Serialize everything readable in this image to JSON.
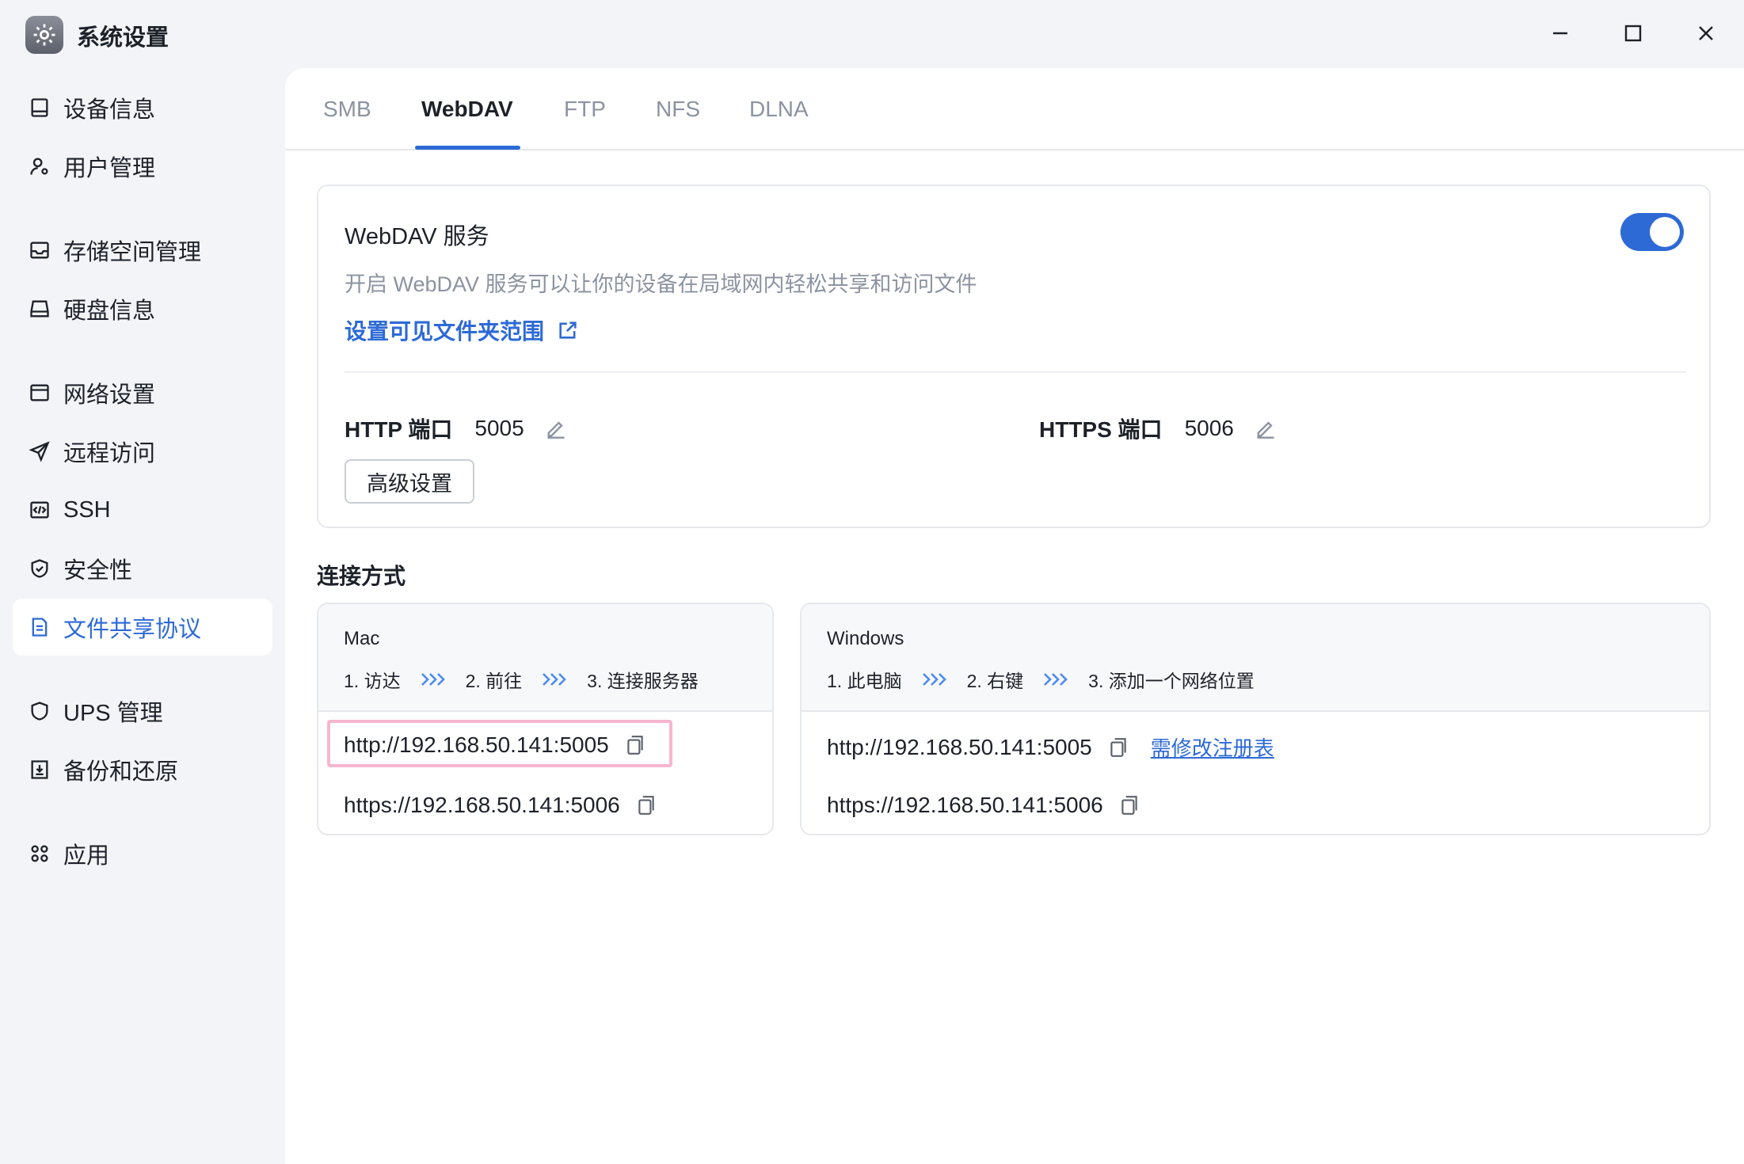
{
  "window": {
    "title": "系统设置"
  },
  "sidebar": {
    "items": [
      {
        "label": "设备信息",
        "icon": "device-icon"
      },
      {
        "label": "用户管理",
        "icon": "user-gear-icon"
      },
      {
        "label": "存储空间管理",
        "icon": "inbox-icon"
      },
      {
        "label": "硬盘信息",
        "icon": "disk-icon"
      },
      {
        "label": "网络设置",
        "icon": "network-icon"
      },
      {
        "label": "远程访问",
        "icon": "send-icon"
      },
      {
        "label": "SSH",
        "icon": "code-icon"
      },
      {
        "label": "安全性",
        "icon": "shield-check-icon"
      },
      {
        "label": "文件共享协议",
        "icon": "document-icon",
        "active": true
      },
      {
        "label": "UPS 管理",
        "icon": "shield-icon"
      },
      {
        "label": "备份和还原",
        "icon": "backup-icon"
      },
      {
        "label": "应用",
        "icon": "apps-icon"
      }
    ]
  },
  "tabs": [
    {
      "label": "SMB"
    },
    {
      "label": "WebDAV",
      "active": true
    },
    {
      "label": "FTP"
    },
    {
      "label": "NFS"
    },
    {
      "label": "DLNA"
    }
  ],
  "service": {
    "title": "WebDAV 服务",
    "description": "开启 WebDAV 服务可以让你的设备在局域网内轻松共享和访问文件",
    "folder_link": "设置可见文件夹范围",
    "enabled": true,
    "http_label": "HTTP 端口",
    "http_port": "5005",
    "https_label": "HTTPS 端口",
    "https_port": "5006",
    "advanced_button": "高级设置"
  },
  "connection": {
    "title": "连接方式",
    "mac": {
      "os": "Mac",
      "steps": [
        "1. 访达",
        "2. 前往",
        "3. 连接服务器"
      ],
      "http_url": "http://192.168.50.141:5005",
      "https_url": "https://192.168.50.141:5006"
    },
    "windows": {
      "os": "Windows",
      "steps": [
        "1. 此电脑",
        "2. 右键",
        "3. 添加一个网络位置"
      ],
      "http_url": "http://192.168.50.141:5005",
      "registry_link": "需修改注册表",
      "https_url": "https://192.168.50.141:5006"
    }
  },
  "colors": {
    "accent": "#2d6ad6",
    "highlight": "#f5b6ce"
  }
}
